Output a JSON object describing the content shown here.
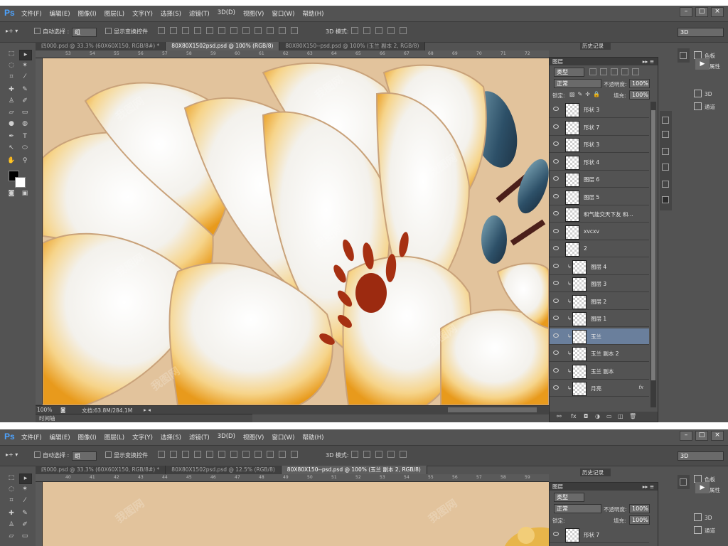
{
  "app": {
    "logo": "Ps"
  },
  "menu": [
    "文件(F)",
    "编辑(E)",
    "图像(I)",
    "图层(L)",
    "文字(Y)",
    "选择(S)",
    "滤镜(T)",
    "3D(D)",
    "视图(V)",
    "窗口(W)",
    "帮助(H)"
  ],
  "window_buttons": [
    "–",
    "□",
    "×"
  ],
  "options": {
    "auto_select_label": "自动选择 :",
    "auto_select_value": "组",
    "show_transform_label": "显示变换控件",
    "mode_3d_label": "3D 模式:",
    "workspace_value": "3D"
  },
  "top": {
    "tabs": [
      {
        "label": "四000.psd @ 33.3% (60X60X150, RGB/8#) *",
        "active": false
      },
      {
        "label": "80X80X1502psd.psd @ 100% (RGB/8)",
        "active": true
      },
      {
        "label": "80X80X150--psd.psd @ 100% (玉兰 副本 2, RGB/8)",
        "active": false
      }
    ],
    "ruler_ticks": [
      "53",
      "54",
      "55",
      "56",
      "57",
      "58",
      "59",
      "60",
      "61",
      "62",
      "63",
      "64",
      "65",
      "66",
      "67",
      "68",
      "69",
      "70",
      "71",
      "72"
    ],
    "status_zoom": "100%",
    "status_doc": "文档:63.8M/284.1M",
    "timeline": "时间轴",
    "history_label": "历史记录"
  },
  "bottom": {
    "tabs": [
      {
        "label": "四000.psd @ 33.3% (60X60X150, RGB/8#) *",
        "active": false
      },
      {
        "label": "80X80X1502psd.psd @ 12.5% (RGB/8)",
        "active": false
      },
      {
        "label": "80X80X150--psd.psd @ 100% (玉兰 副本 2, RGB/8)",
        "active": true
      }
    ],
    "ruler_ticks": [
      "40",
      "41",
      "42",
      "43",
      "44",
      "45",
      "46",
      "47",
      "48",
      "49",
      "50",
      "51",
      "52",
      "53",
      "54",
      "55",
      "56",
      "57",
      "58",
      "59"
    ],
    "history_label": "历史记录"
  },
  "layers_panel": {
    "title": "图层",
    "filter_value": "类型",
    "blend_mode": "正常",
    "opacity_label": "不透明度:",
    "opacity_value": "100%",
    "lock_label": "锁定:",
    "fill_label": "填充:",
    "fill_value": "100%",
    "layers": [
      {
        "name": "形状 3",
        "clipped": false,
        "selected": false,
        "fx": false
      },
      {
        "name": "形状 7",
        "clipped": false,
        "selected": false,
        "fx": false
      },
      {
        "name": "形状 3",
        "clipped": false,
        "selected": false,
        "fx": false
      },
      {
        "name": "形状 4",
        "clipped": false,
        "selected": false,
        "fx": false
      },
      {
        "name": "图层 6",
        "clipped": false,
        "selected": false,
        "fx": false
      },
      {
        "name": "图层 5",
        "clipped": false,
        "selected": false,
        "fx": false
      },
      {
        "name": "和气能交天下友    和...",
        "clipped": false,
        "selected": false,
        "fx": false
      },
      {
        "name": "xvcxv",
        "clipped": false,
        "selected": false,
        "fx": false
      },
      {
        "name": "2",
        "clipped": false,
        "selected": false,
        "fx": false
      },
      {
        "name": "图层 4",
        "clipped": true,
        "selected": false,
        "fx": false
      },
      {
        "name": "图层 3",
        "clipped": true,
        "selected": false,
        "fx": false
      },
      {
        "name": "图层 2",
        "clipped": true,
        "selected": false,
        "fx": false
      },
      {
        "name": "图层 1",
        "clipped": true,
        "selected": false,
        "fx": false
      },
      {
        "name": "玉兰",
        "clipped": true,
        "selected": true,
        "fx": false
      },
      {
        "name": "玉兰 副本 2",
        "clipped": true,
        "selected": false,
        "fx": false
      },
      {
        "name": "玉兰 副本",
        "clipped": true,
        "selected": false,
        "fx": false
      },
      {
        "name": "月亮",
        "clipped": true,
        "selected": false,
        "fx": true
      }
    ],
    "bottom_layers": [
      {
        "name": "形状 7"
      }
    ]
  },
  "right_dock": {
    "items": [
      "色板",
      "属性",
      "3D",
      "通道"
    ]
  },
  "watermark": "我图网"
}
